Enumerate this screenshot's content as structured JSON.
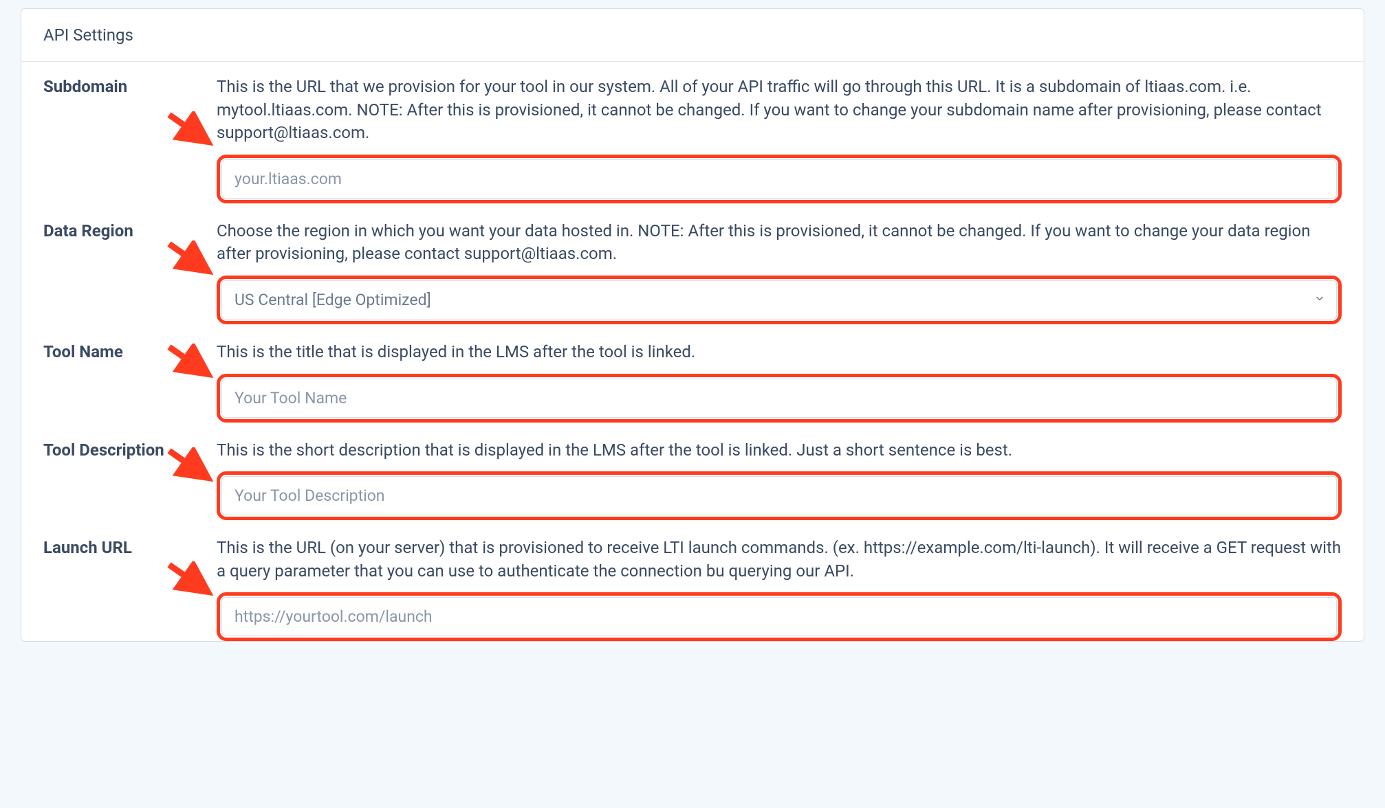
{
  "card": {
    "title": "API Settings"
  },
  "fields": {
    "subdomain": {
      "label": "Subdomain",
      "help": "This is the URL that we provision for your tool in our system. All of your API traffic will go through this URL. It is a subdomain of ltiaas.com. i.e. mytool.ltiaas.com. NOTE: After this is provisioned, it cannot be changed. If you want to change your subdomain name after provisioning, please contact support@ltiaas.com.",
      "placeholder": "your.ltiaas.com"
    },
    "data_region": {
      "label": "Data Region",
      "help": "Choose the region in which you want your data hosted in. NOTE: After this is provisioned, it cannot be changed. If you want to change your data region after provisioning, please contact support@ltiaas.com.",
      "selected": "US Central [Edge Optimized]"
    },
    "tool_name": {
      "label": "Tool Name",
      "help": "This is the title that is displayed in the LMS after the tool is linked.",
      "placeholder": "Your Tool Name"
    },
    "tool_description": {
      "label": "Tool Description",
      "help": "This is the short description that is displayed in the LMS after the tool is linked. Just a short sentence is best.",
      "placeholder": "Your Tool Description"
    },
    "launch_url": {
      "label": "Launch URL",
      "help": "This is the URL (on your server) that is provisioned to receive LTI launch commands. (ex. https://example.com/lti-launch). It will receive a GET request with a query parameter that you can use to authenticate the connection bu querying our API.",
      "placeholder": "https://yourtool.com/launch"
    }
  }
}
